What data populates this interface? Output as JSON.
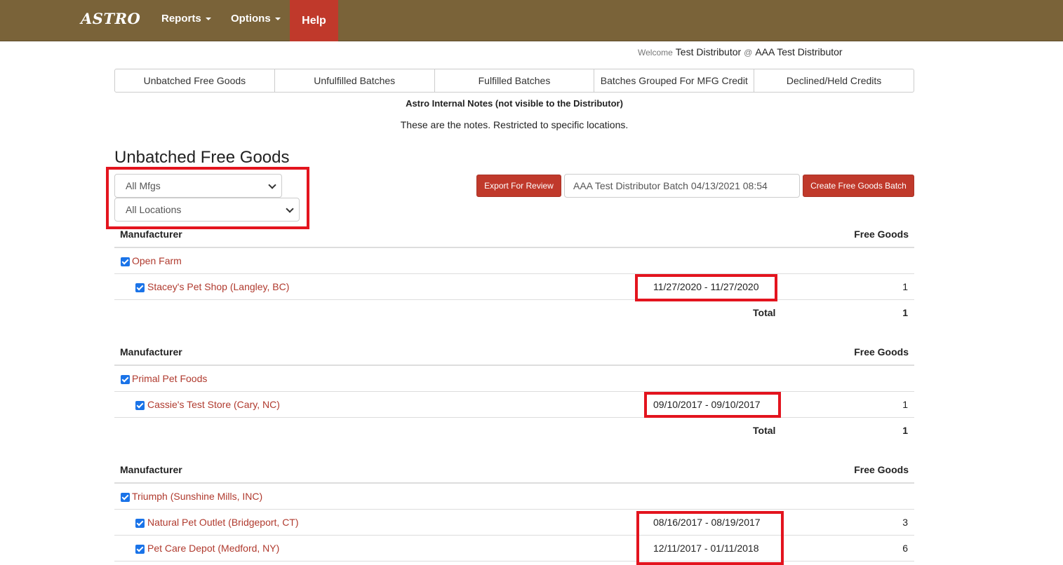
{
  "nav": {
    "brand": "ASTRO",
    "reports": "Reports",
    "options": "Options",
    "help": "Help"
  },
  "welcome": {
    "label": "Welcome",
    "user": "Test Distributor",
    "at": "@",
    "org": "AAA Test Distributor"
  },
  "tabs": [
    "Unbatched Free Goods",
    "Unfulfilled Batches",
    "Fulfilled Batches",
    "Batches Grouped For MFG Credit",
    "Declined/Held Credits"
  ],
  "notes": {
    "title": "Astro Internal Notes (not visible to the Distributor)",
    "body": "These are the notes. Restricted to specific locations."
  },
  "page_title": "Unbatched Free Goods",
  "filters": {
    "mfg": "All Mfgs",
    "location": "All Locations"
  },
  "actions": {
    "export": "Export For Review",
    "batch_name": "AAA Test Distributor  Batch 04/13/2021 08:54",
    "create": "Create Free Goods Batch"
  },
  "table": {
    "col_manufacturer": "Manufacturer",
    "col_free_goods": "Free Goods",
    "total_label": "Total"
  },
  "groups": [
    {
      "manufacturer": "Open Farm",
      "rows": [
        {
          "location": "Stacey's Pet Shop (Langley, BC)",
          "dates": "11/27/2020 - 11/27/2020",
          "qty": "1"
        }
      ],
      "total": "1"
    },
    {
      "manufacturer": "Primal Pet Foods",
      "rows": [
        {
          "location": "Cassie's Test Store (Cary, NC)",
          "dates": "09/10/2017 - 09/10/2017",
          "qty": "1"
        }
      ],
      "total": "1"
    },
    {
      "manufacturer": "Triumph (Sunshine Mills, INC)",
      "rows": [
        {
          "location": "Natural Pet Outlet (Bridgeport, CT)",
          "dates": "08/16/2017 - 08/19/2017",
          "qty": "3"
        },
        {
          "location": "Pet Care Depot (Medford, NY)",
          "dates": "12/11/2017 - 01/11/2018",
          "qty": "6"
        }
      ]
    }
  ]
}
